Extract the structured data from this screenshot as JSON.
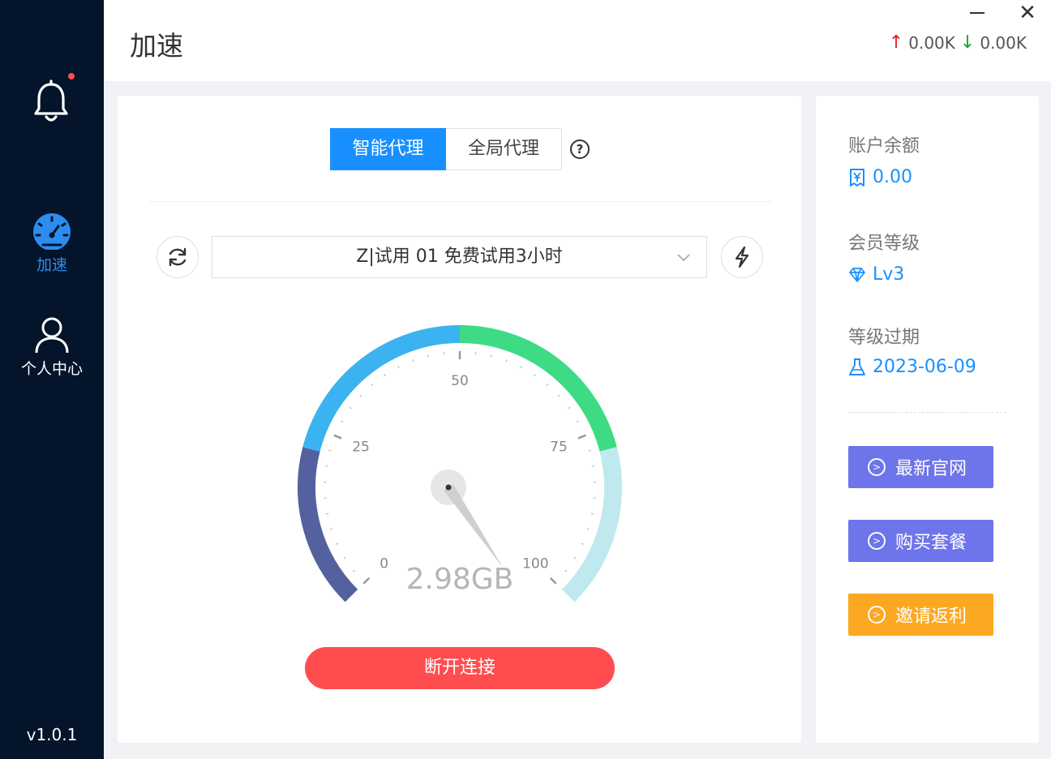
{
  "sidebar": {
    "nav": [
      {
        "label": "加速",
        "icon": "speedometer-icon",
        "active": true
      },
      {
        "label": "个人中心",
        "icon": "user-icon",
        "active": false
      }
    ],
    "version": "v1.0.1",
    "notification_icon": "bell-icon",
    "notification_dot_color": "#ff4d4f"
  },
  "header": {
    "title": "加速",
    "upload_speed": "0.00K",
    "download_speed": "0.00K",
    "upload_icon": "arrow-up-icon",
    "download_icon": "arrow-down-icon"
  },
  "main": {
    "modes": [
      "智能代理",
      "全局代理"
    ],
    "active_mode": "智能代理",
    "help_icon": "question-circle-icon",
    "node_selected": "Z|试用 01 免费试用3小时",
    "refresh_icon": "refresh-icon",
    "test_icon": "lightning-icon",
    "gauge": {
      "value": 2.98,
      "unit": "GB",
      "display": "2.98GB",
      "min": 0,
      "max": 100,
      "needle_pct": 104,
      "tick_labels": [
        "0",
        "25",
        "50",
        "75",
        "100"
      ],
      "band_colors": [
        "#54619e",
        "#3ab3f0",
        "#3ddc84",
        "#bfe9ef"
      ]
    },
    "disconnect_label": "断开连接"
  },
  "account": {
    "balance_label": "账户余额",
    "balance_value": "0.00",
    "balance_icon": "yen-receipt-icon",
    "level_label": "会员等级",
    "level_value": "Lv3",
    "level_icon": "diamond-icon",
    "expiry_label": "等级过期",
    "expiry_value": "2023-06-09",
    "expiry_icon": "flask-icon",
    "buttons": [
      {
        "label": "最新官网",
        "color": "#6e74ea"
      },
      {
        "label": "购买套餐",
        "color": "#6e74ea"
      },
      {
        "label": "邀请返利",
        "color": "#fca822"
      }
    ]
  },
  "colors": {
    "accent": "#1890ff",
    "sidebar_bg": "#04142b",
    "danger": "#ff4d4f"
  }
}
